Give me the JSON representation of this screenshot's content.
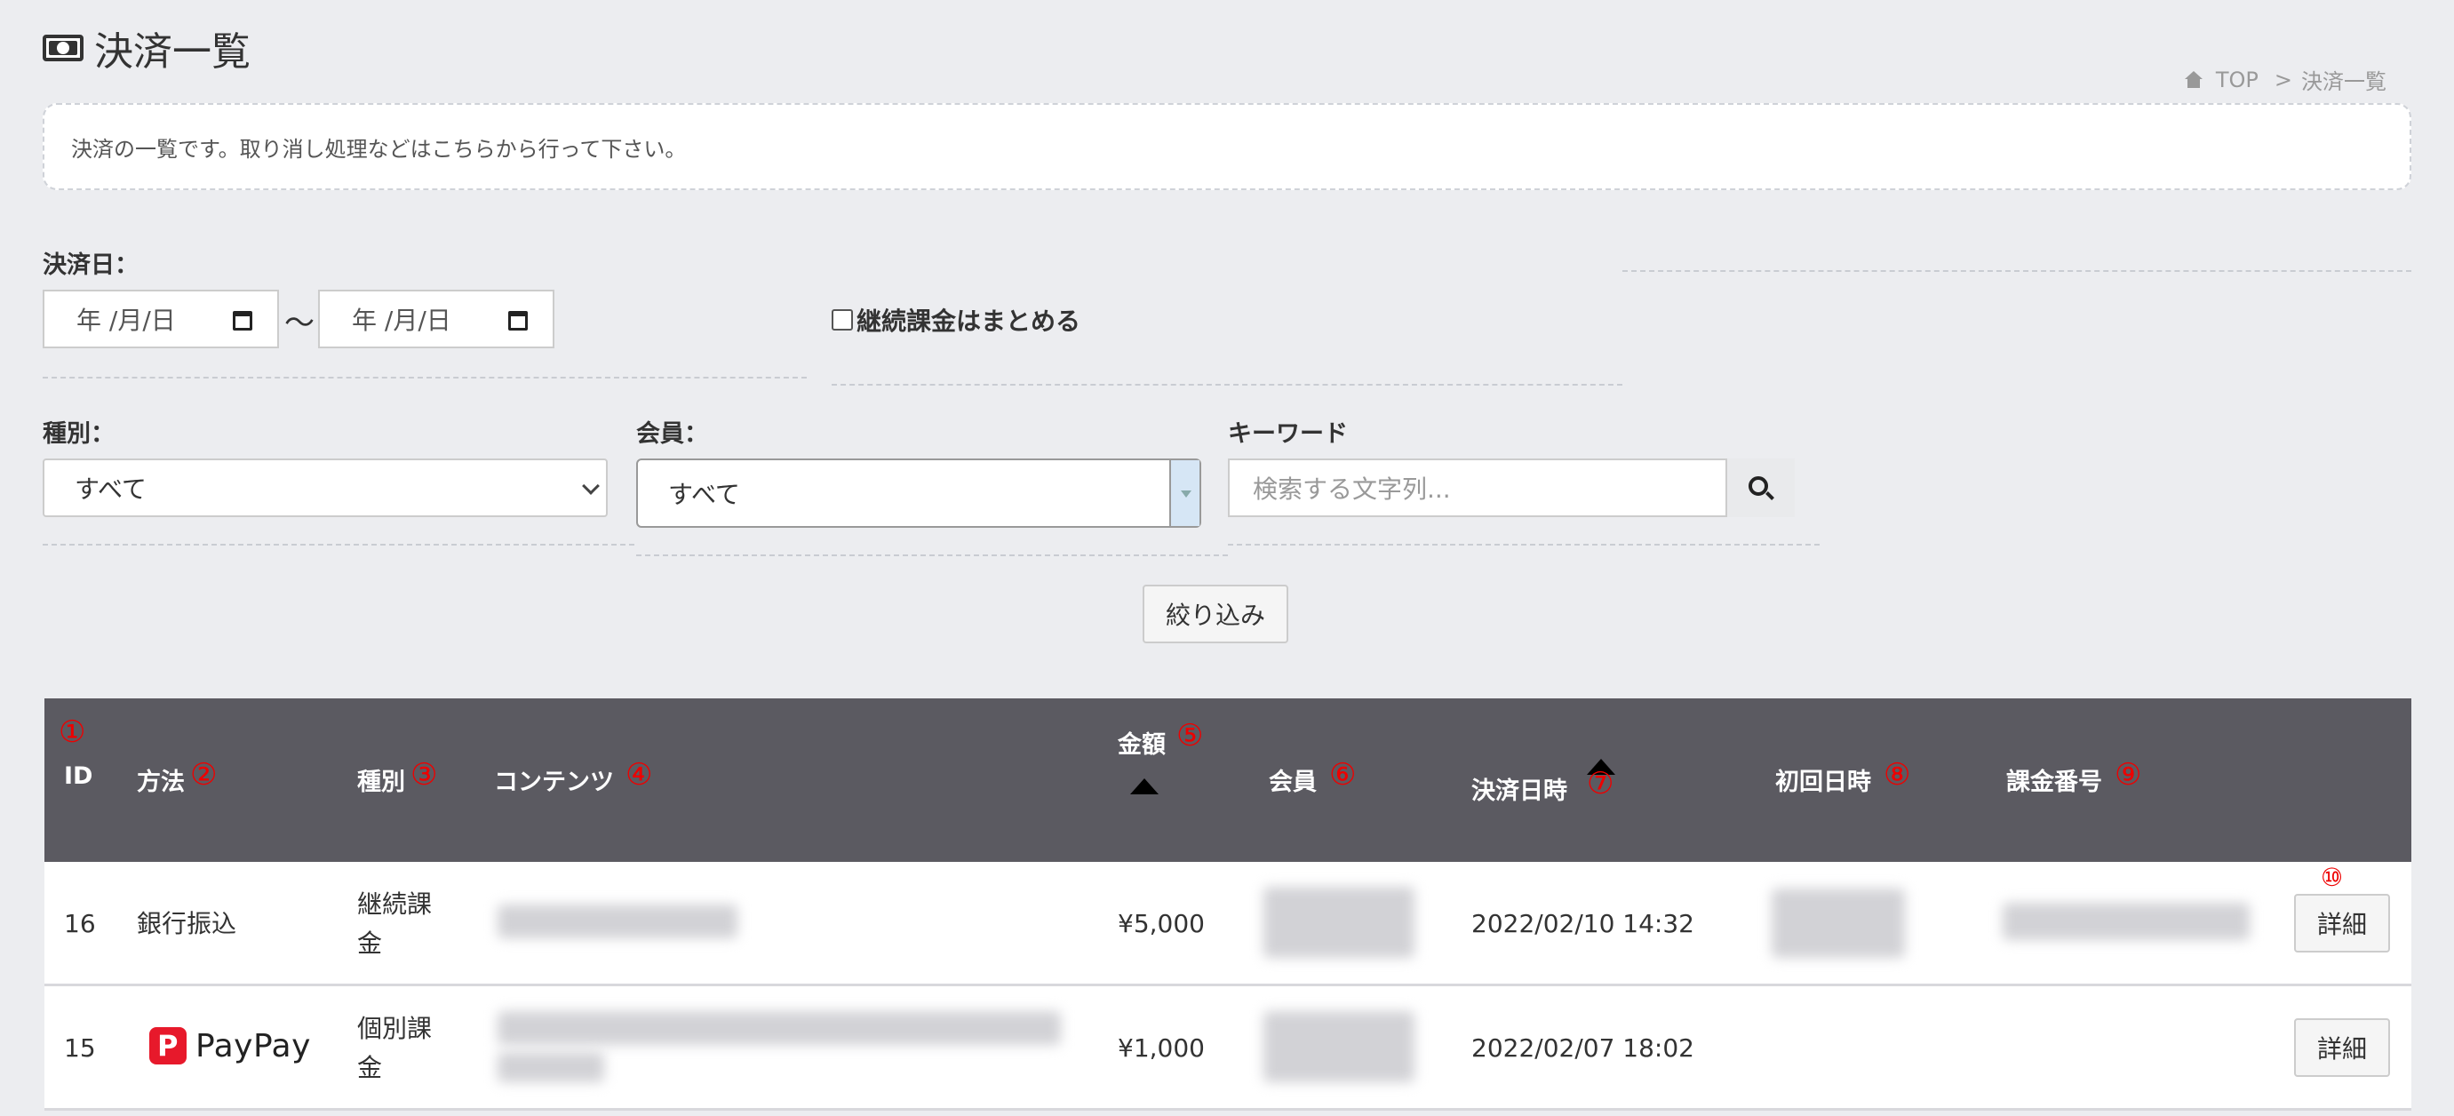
{
  "header": {
    "title": "決済一覧",
    "breadcrumb": {
      "home": "TOP",
      "separator": ">",
      "current": "決済一覧"
    }
  },
  "info": "決済の一覧です。取り消し処理などはこちらから行って下さい。",
  "filters": {
    "date_label": "決済日：",
    "date_from_placeholder": "年 /月/日",
    "date_to_placeholder": "年 /月/日",
    "range_separator": "〜",
    "group_recurring_label": "継続課金はまとめる",
    "group_recurring_checked": false,
    "type_label": "種別：",
    "type_value": "すべて",
    "member_label": "会員：",
    "member_value": "すべて",
    "keyword_label": "キーワード",
    "keyword_placeholder": "検索する文字列...",
    "submit_label": "絞り込み"
  },
  "table": {
    "headers": {
      "id": "ID",
      "id_num": "①",
      "method": "方法",
      "method_num": "②",
      "type": "種別",
      "type_num": "③",
      "content": "コンテンツ",
      "content_num": "④",
      "amount": "金額",
      "amount_num": "⑤",
      "member": "会員",
      "member_num": "⑥",
      "paid_at": "決済日時",
      "paid_at_num": "⑦",
      "first_at": "初回日時",
      "first_at_num": "⑧",
      "billing_no": "課金番号",
      "billing_no_num": "⑨",
      "detail_num": "⑩"
    },
    "rows": [
      {
        "id": "16",
        "method": "銀行振込",
        "type_line1": "継続課",
        "type_line2": "金",
        "amount": "¥5,000",
        "paid_at": "2022/02/10 14:32",
        "detail": "詳細"
      },
      {
        "id": "15",
        "method": "PayPay",
        "method_icon": "paypay-logo",
        "type_line1": "個別課",
        "type_line2": "金",
        "amount": "¥1,000",
        "paid_at": "2022/02/07 18:02",
        "detail": "詳細"
      }
    ]
  },
  "colors": {
    "table_header_bg": "#5b5a61",
    "annotation_red": "#e00000",
    "paypay_red": "#e7192b"
  }
}
